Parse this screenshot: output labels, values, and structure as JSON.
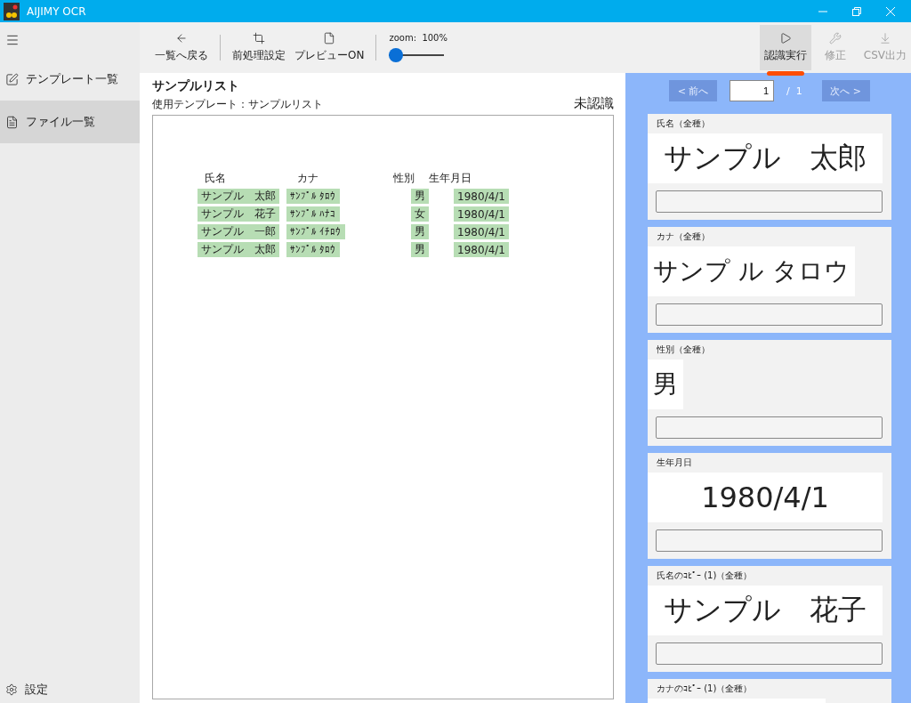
{
  "window": {
    "title": "AIJIMY OCR"
  },
  "sidebar": {
    "items": [
      {
        "label": "テンプレート一覧",
        "kind": "template",
        "selected": false
      },
      {
        "label": "ファイル一覧",
        "kind": "file",
        "selected": true
      }
    ],
    "footer": {
      "label": "設定"
    }
  },
  "toolbar": {
    "left": [
      {
        "label": "一覧へ戻る",
        "kind": "back"
      },
      {
        "label": "前処理設定",
        "kind": "crop"
      },
      {
        "label": "プレビューON",
        "kind": "file"
      }
    ],
    "zoom": {
      "label": "zoom:  100%",
      "level": 0
    },
    "right": [
      {
        "label": "認識実行",
        "kind": "play",
        "selected": true,
        "disabled": false
      },
      {
        "label": "修正",
        "kind": "wrench",
        "selected": false,
        "disabled": true
      },
      {
        "label": "CSV出力",
        "kind": "download",
        "selected": false,
        "disabled": true
      }
    ]
  },
  "document": {
    "title": "サンプルリスト",
    "template": "使用テンプレート：サンプルリスト",
    "status": "未認識",
    "sheet": {
      "headers": [
        "氏名",
        "カナ",
        "性別",
        "生年月日"
      ],
      "rows": [
        [
          "サンプル　太郎",
          "ｻﾝﾌﾟﾙ ﾀﾛｳ",
          "男",
          "1980/4/1"
        ],
        [
          "サンプル　花子",
          "ｻﾝﾌﾟﾙ ﾊﾅｺ",
          "女",
          "1980/4/1"
        ],
        [
          "サンプル　一郎",
          "ｻﾝﾌﾟﾙ ｲﾁﾛｳ",
          "男",
          "1980/4/1"
        ],
        [
          "サンプル　太郎",
          "ｻﾝﾌﾟﾙ ﾀﾛｳ",
          "男",
          "1980/4/1"
        ]
      ]
    }
  },
  "pager": {
    "prev": {
      "label": "< 前へ",
      "disabled": true
    },
    "page": "1",
    "total": "/  1",
    "next": {
      "label": "次へ >",
      "disabled": true
    }
  },
  "fields": [
    {
      "label": "氏名（全種）",
      "snippet": "サンプル　太郎",
      "wide": true
    },
    {
      "label": "カナ（全種）",
      "snippet": "サンプ ル タロウ",
      "wide": false
    },
    {
      "label": "性別（全種）",
      "snippet": "男",
      "wide": false
    },
    {
      "label": "生年月日",
      "snippet": "1980/4/1",
      "wide": true
    },
    {
      "label": "氏名のｺﾋﾟｰ (1)（全種）",
      "snippet": "サンプル　花子",
      "wide": true
    },
    {
      "label": "カナのｺﾋﾟｰ (1)（全種）"
    }
  ]
}
